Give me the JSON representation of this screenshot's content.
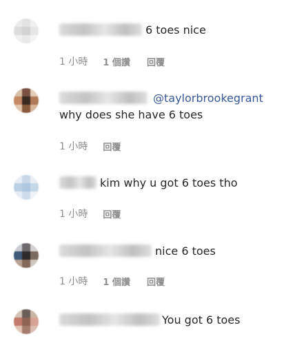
{
  "comments": [
    {
      "text": "6 toes nice",
      "mention": "",
      "time": "1 小時",
      "likes": "1 個讚",
      "reply": "回覆",
      "avatar_colors": [
        "#ececec",
        "#e2e2e2",
        "#f0f0f0",
        "#dddddd",
        "#d2d2d2",
        "#e6e6e6",
        "#efefef",
        "#e9e9e9",
        "#f4f4f4"
      ]
    },
    {
      "text": "why does she have 6 toes",
      "mention": "@taylorbrookegrant",
      "time": "1 小時",
      "likes": "",
      "reply": "回覆",
      "avatar_colors": [
        "#d9c0a8",
        "#7a5140",
        "#e4cdb8",
        "#c48a64",
        "#3b2a22",
        "#b07a58",
        "#e2c6ae",
        "#8a5a3e",
        "#d6b59a"
      ]
    },
    {
      "text": "kim why u got 6 toes tho",
      "mention": "",
      "time": "1 小時",
      "likes": "",
      "reply": "回覆",
      "avatar_colors": [
        "#e6edf4",
        "#c8d8e8",
        "#e9eff5",
        "#bcd0e4",
        "#aec6df",
        "#c6d7e8",
        "#e7eef5",
        "#cddcea",
        "#eef3f8"
      ]
    },
    {
      "text": "nice 6 toes",
      "mention": "",
      "time": "1 小時",
      "likes": "1 個讚",
      "reply": "回覆",
      "avatar_colors": [
        "#c9ccd1",
        "#6d6a6e",
        "#d6d4d2",
        "#3e5a78",
        "#2f2a2a",
        "#7b6a5f",
        "#b8a394",
        "#84685a",
        "#cfc7bf"
      ]
    },
    {
      "text": "You got 6 toes",
      "mention": "",
      "time": "",
      "likes": "",
      "reply": "",
      "avatar_colors": [
        "#d3c4b8",
        "#6b5e58",
        "#cbb5a5",
        "#c27a6c",
        "#8d6455",
        "#d7a296",
        "#e2c4b6",
        "#a57d70",
        "#d9bdb0"
      ]
    }
  ]
}
